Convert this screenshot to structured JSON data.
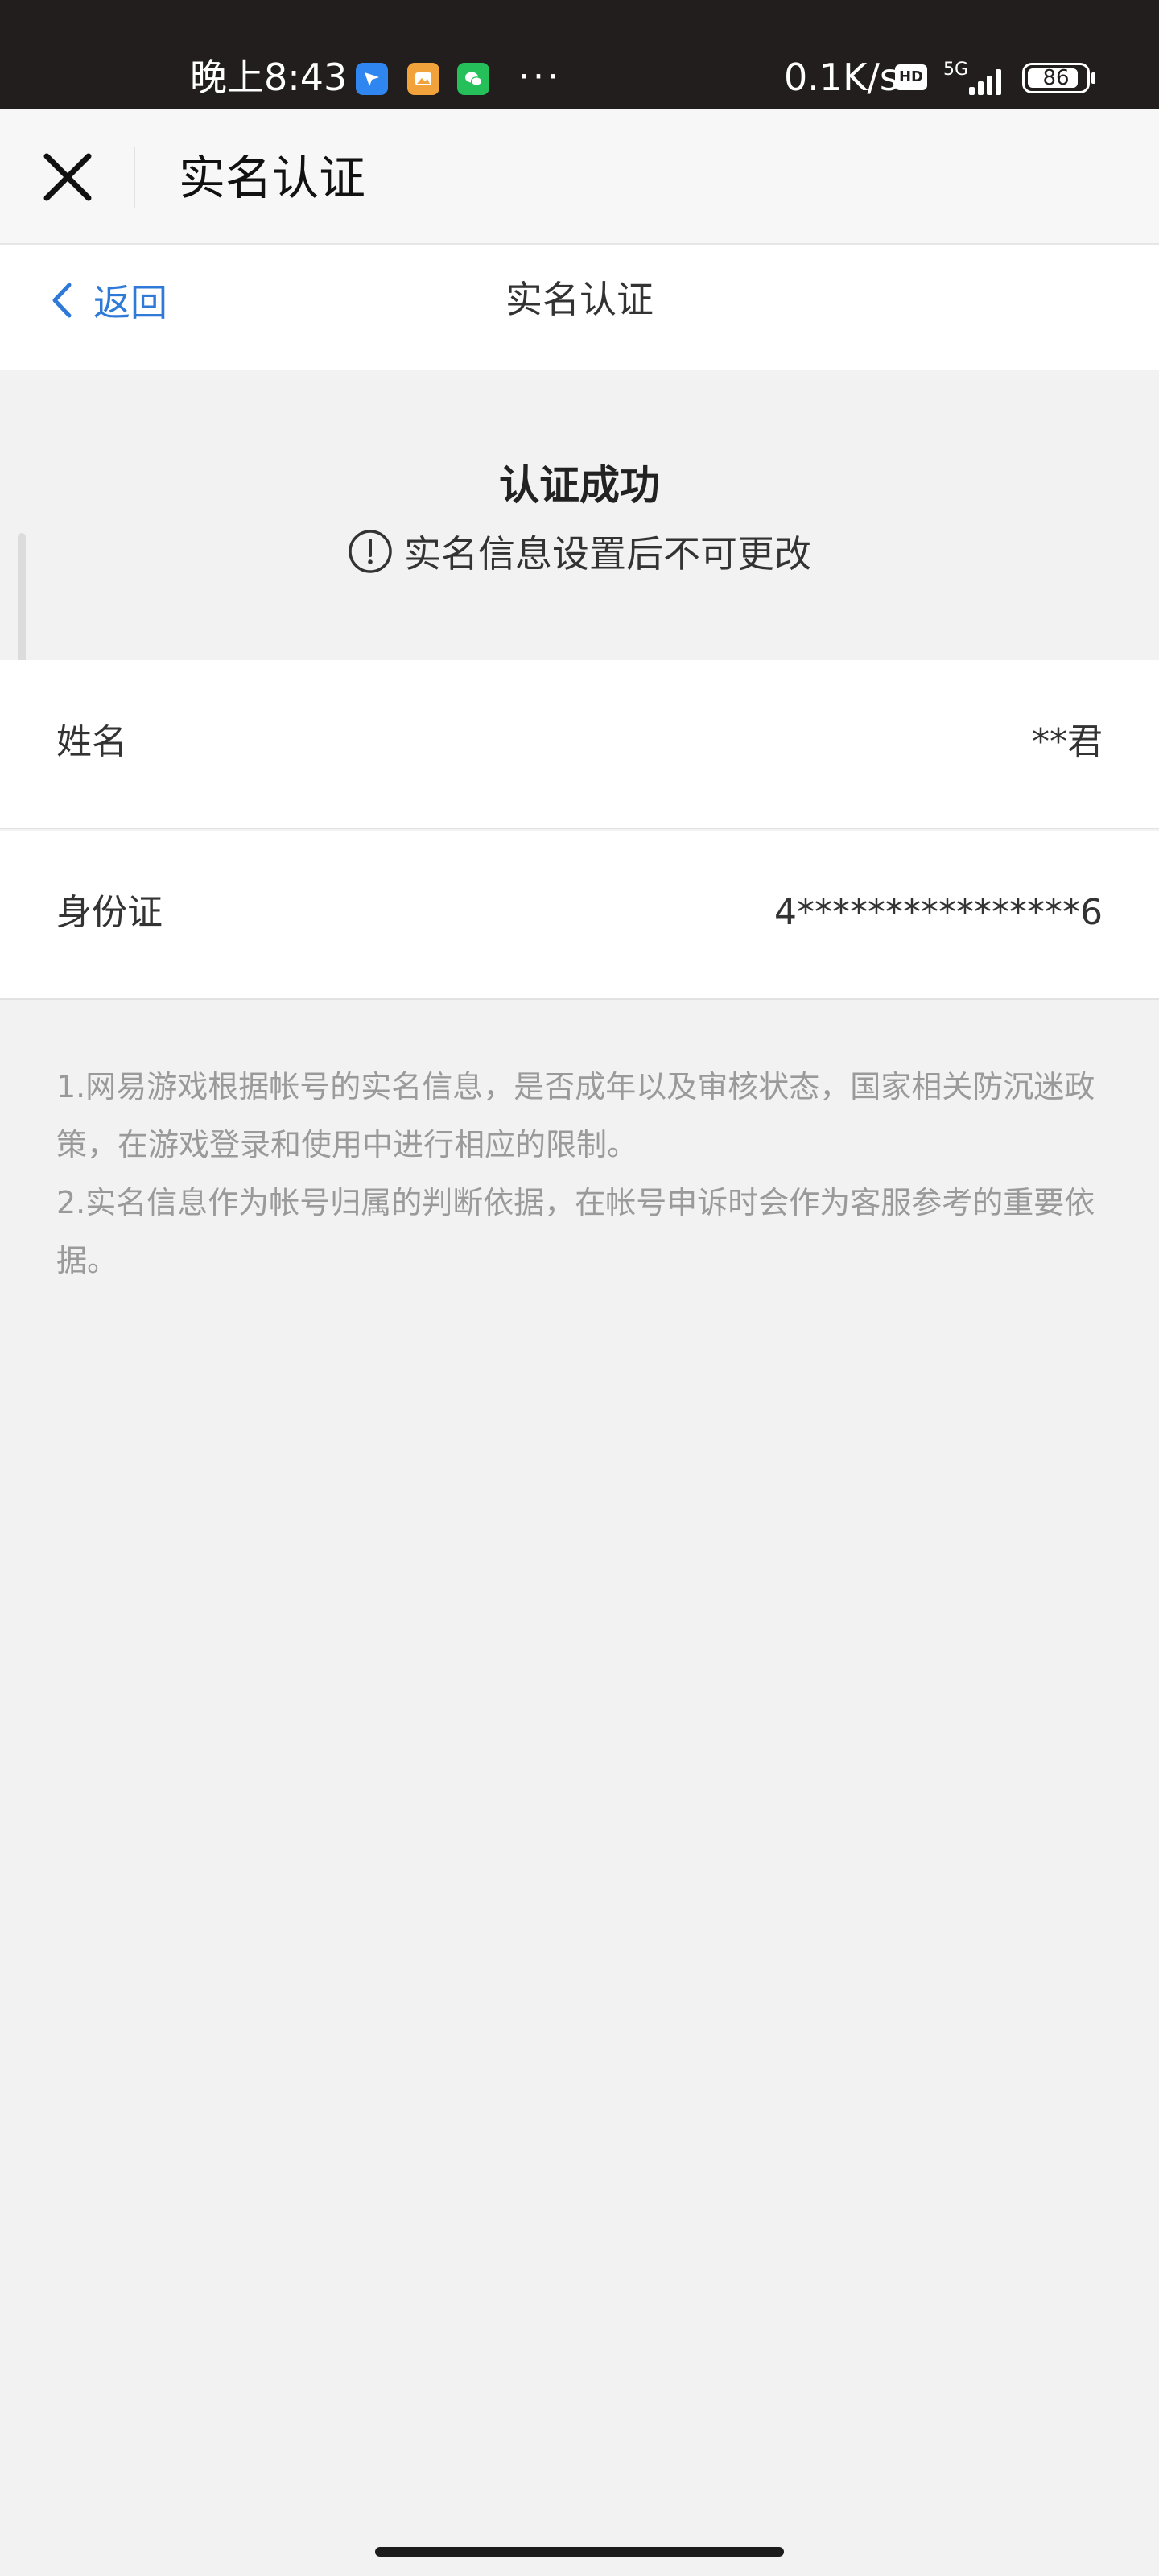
{
  "status_bar": {
    "time": "晚上8:43",
    "more": "···",
    "speed": "0.1K/s",
    "hd": "HD",
    "network": "5G",
    "battery": "86",
    "app_icons": [
      "feishu-icon",
      "gallery-icon",
      "wechat-icon"
    ]
  },
  "titlebar": {
    "title": "实名认证",
    "close_icon": "close-icon"
  },
  "navbar": {
    "back_label": "返回",
    "title": "实名认证"
  },
  "success": {
    "title": "认证成功",
    "note": "实名信息设置后不可更改",
    "note_icon": "exclamation-circle-icon"
  },
  "fields": [
    {
      "label": "姓名",
      "value": "**君"
    },
    {
      "label": "身份证",
      "value": "4****************6"
    }
  ],
  "notes": [
    "1.网易游戏根据帐号的实名信息，是否成年以及审核状态，国家相关防沉迷政策，在游戏登录和使用中进行相应的限制。",
    "2.实名信息作为帐号归属的判断依据，在帐号申诉时会作为客服参考的重要依据。"
  ],
  "colors": {
    "accent": "#2f7ad8",
    "status_bar": "#221e1e",
    "page_bg": "#f2f2f2",
    "note_text": "#9a9a9a"
  }
}
